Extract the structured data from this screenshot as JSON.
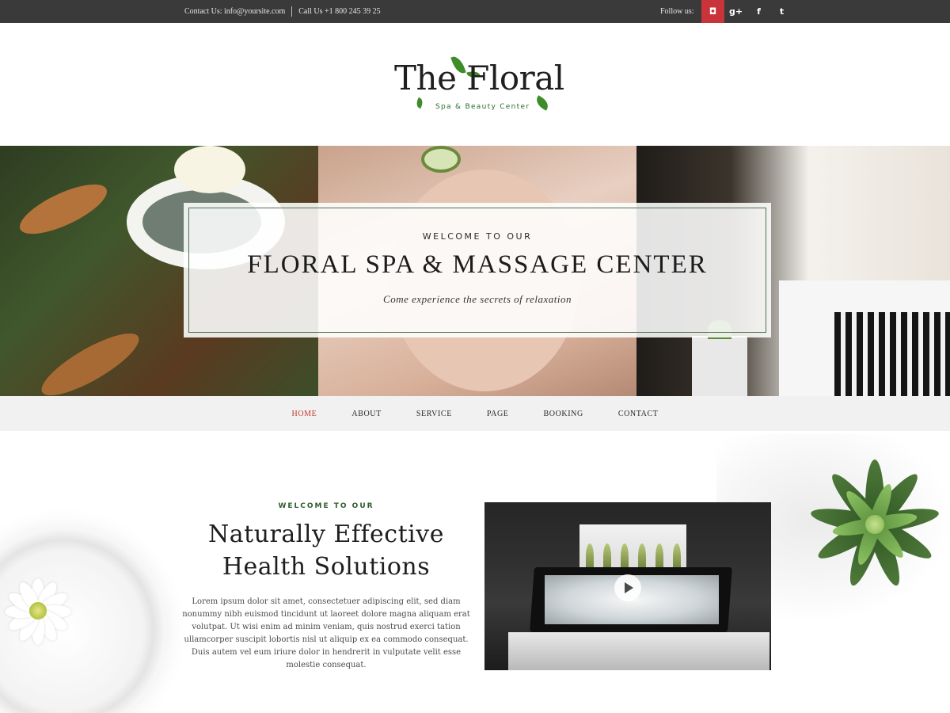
{
  "topbar": {
    "contact_text": "Contact Us: info@yoursite.com",
    "call_text": "Call Us +1 800 245 39 25",
    "follow_label": "Follow us:",
    "socials": [
      {
        "name": "instagram",
        "glyph": "◘"
      },
      {
        "name": "google-plus",
        "glyph": "g+"
      },
      {
        "name": "facebook",
        "glyph": "f"
      },
      {
        "name": "twitter",
        "glyph": "t"
      }
    ],
    "active_color": "#c9343a"
  },
  "logo": {
    "title": "The Floral",
    "tagline": "Spa & Beauty Center"
  },
  "hero": {
    "kicker": "WELCOME TO OUR",
    "headline": "FLORAL SPA & MASSAGE CENTER",
    "subtitle": "Come experience the secrets of relaxation"
  },
  "nav": {
    "items": [
      {
        "label": "HOME",
        "active": true
      },
      {
        "label": "ABOUT",
        "active": false
      },
      {
        "label": "SERVICE",
        "active": false
      },
      {
        "label": "PAGE",
        "active": false
      },
      {
        "label": "BOOKING",
        "active": false
      },
      {
        "label": "CONTACT",
        "active": false
      }
    ],
    "active_color": "#c0392b"
  },
  "intro": {
    "kicker": "WELCOME TO OUR",
    "heading_line1": "Naturally Effective",
    "heading_line2": "Health Solutions",
    "body": "Lorem ipsum dolor sit amet, consectetuer adipiscing elit, sed diam nonummy nibh euismod tincidunt ut laoreet dolore magna aliquam erat volutpat. Ut wisi enim ad minim veniam, quis nostrud exerci tation ullamcorper suscipit lobortis nisl ut aliquip ex ea commodo consequat. Duis autem vel eum iriure dolor in hendrerit in vulputate velit esse molestie consequat."
  },
  "video": {
    "play_icon": "play-icon"
  }
}
